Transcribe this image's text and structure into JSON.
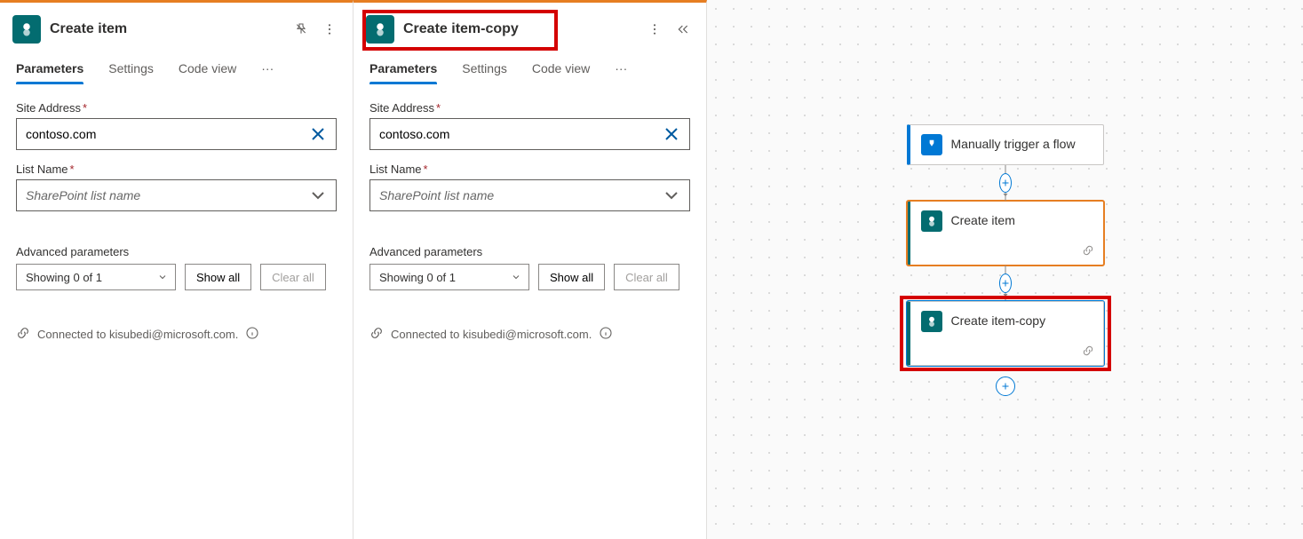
{
  "panel_left": {
    "title": "Create item",
    "tabs": {
      "parameters": "Parameters",
      "settings": "Settings",
      "codeview": "Code view"
    },
    "site_address": {
      "label": "Site Address",
      "value": "contoso.com"
    },
    "list_name": {
      "label": "List Name",
      "placeholder": "SharePoint list name"
    },
    "advanced": {
      "label": "Advanced parameters",
      "showing": "Showing 0 of 1",
      "show_all": "Show all",
      "clear_all": "Clear all"
    },
    "connection": "Connected to kisubedi@microsoft.com."
  },
  "panel_mid": {
    "title": "Create item-copy",
    "tabs": {
      "parameters": "Parameters",
      "settings": "Settings",
      "codeview": "Code view"
    },
    "site_address": {
      "label": "Site Address",
      "value": "contoso.com"
    },
    "list_name": {
      "label": "List Name",
      "placeholder": "SharePoint list name"
    },
    "advanced": {
      "label": "Advanced parameters",
      "showing": "Showing 0 of 1",
      "show_all": "Show all",
      "clear_all": "Clear all"
    },
    "connection": "Connected to kisubedi@microsoft.com."
  },
  "canvas": {
    "trigger": "Manually trigger a flow",
    "action1": "Create item",
    "action2": "Create item-copy"
  }
}
